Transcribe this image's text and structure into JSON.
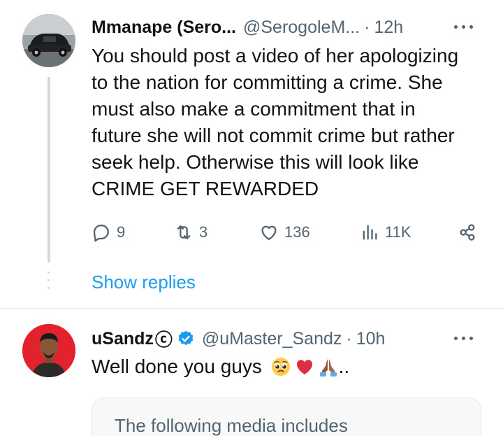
{
  "tweet1": {
    "name": "Mmanape (Sero...",
    "handle": "@SerogoleM...",
    "separator": "·",
    "time": "12h",
    "lines": [
      "You should post a video of her apologizing",
      "to the nation for committing a crime. She",
      "must also make a commitment that in",
      "future she will not commit crime but rather",
      "seek help. Otherwise this will look like",
      "CRIME GET REWARDED"
    ],
    "replies": "9",
    "reposts": "3",
    "likes": "136",
    "views": "11K",
    "show_replies": "Show replies"
  },
  "tweet2": {
    "name": "uSandz",
    "name_suffix": "ⓒ",
    "handle": "@uMaster_Sandz",
    "separator": "·",
    "time": "10h",
    "text": "Well done you guys ",
    "trailing": "..",
    "emojis": [
      "pleading-face-icon",
      "red-heart-icon",
      "folded-hands-icon"
    ],
    "media_notice": "The following media includes"
  },
  "icons": [
    "reply-icon",
    "repost-icon",
    "like-icon",
    "views-icon",
    "share-icon",
    "more-icon",
    "verified-badge-icon"
  ],
  "colors": {
    "accent": "#1d9bf0",
    "muted": "#536471",
    "text": "#0f1419",
    "heart": "#e0245e",
    "avatar2_bg": "#e2232e"
  }
}
